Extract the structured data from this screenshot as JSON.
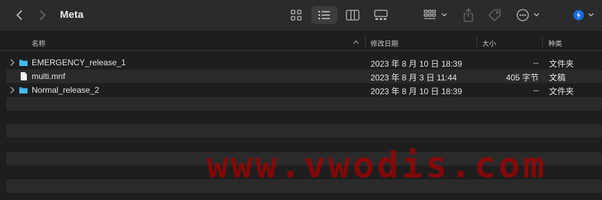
{
  "window": {
    "title": "Meta"
  },
  "toolbar": {
    "icons": [
      "back-chevron-icon",
      "forward-chevron-icon",
      "icon-view-grid-icon",
      "list-view-icon",
      "column-view-icon",
      "gallery-view-icon",
      "group-icon",
      "share-icon",
      "tag-icon",
      "more-actions-icon",
      "account-badge-icon"
    ],
    "selected_view": "list"
  },
  "columns": {
    "name": "名称",
    "modified": "修改日期",
    "size": "大小",
    "kind": "种类",
    "sort": "descending"
  },
  "files": [
    {
      "name": "EMERGENCY_release_1",
      "modified": "2023 年 8 月 10 日 18:39",
      "size": "--",
      "kind": "文件夹",
      "type": "folder"
    },
    {
      "name": "multi.mnf",
      "modified": "2023 年 8 月 3 日 11:44",
      "size": "405 字节",
      "kind": "文稿",
      "type": "document"
    },
    {
      "name": "Normal_release_2",
      "modified": "2023 年 8 月 10 日 18:39",
      "size": "--",
      "kind": "文件夹",
      "type": "folder"
    }
  ],
  "watermark": "www.vwodis.com",
  "colors": {
    "background": "#1e1e1e",
    "toolbar": "#2b2b2b",
    "stripe": "#2a2a2a",
    "folder_blue": "#2ea8e8",
    "account_badge": "#1a6fe0",
    "watermark": "#aa0000"
  }
}
